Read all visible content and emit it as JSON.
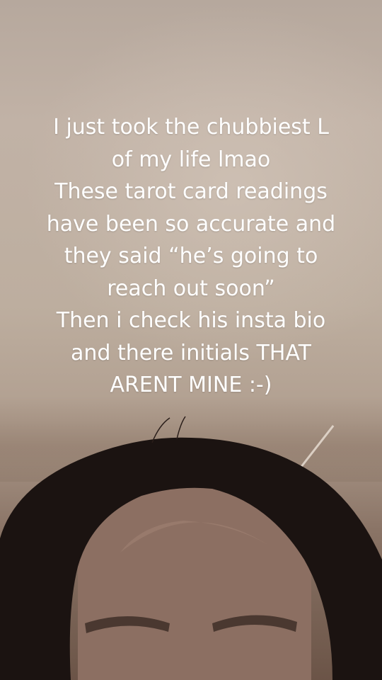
{
  "caption": {
    "lines": [
      "I just took the chubbiest L",
      "of my life lmao",
      "These tarot card readings",
      "have been so accurate and",
      "they said “he’s going to",
      "reach out soon”",
      "Then i check his insta bio",
      "and there initials THAT",
      "ARENT MINE :-)"
    ]
  },
  "colors": {
    "wall": "#bdae9f",
    "hair": "#1a1210",
    "skin": "#8a6e62",
    "text": "#ffffff"
  }
}
